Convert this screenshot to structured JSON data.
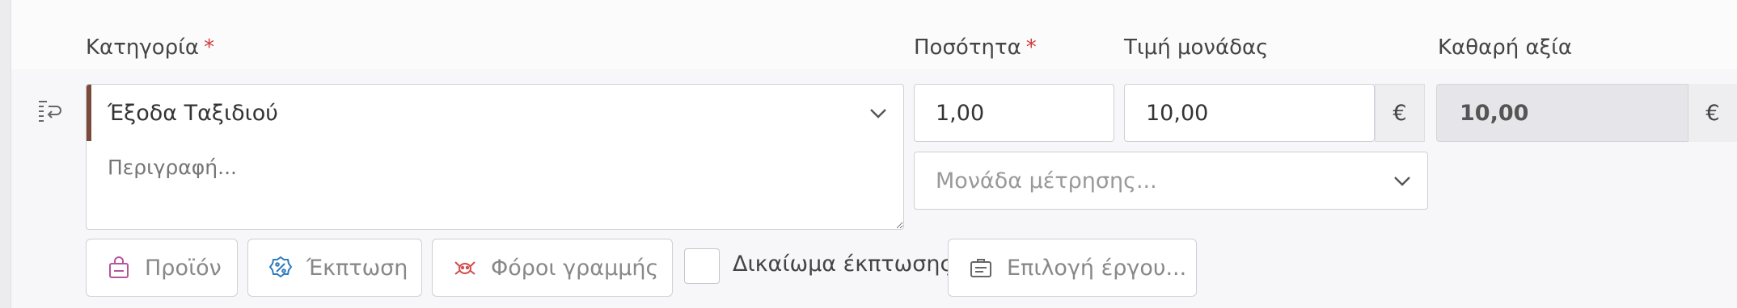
{
  "labels": {
    "category": "Κατηγορία",
    "quantity": "Ποσότητα",
    "unit_price": "Τιμή μονάδας",
    "net_value": "Καθαρή αξία",
    "required_mark": "*"
  },
  "category": {
    "selected": "Έξοδα Ταξιδιού",
    "accent_color": "#7a4a3a"
  },
  "description": {
    "placeholder": "Περιγραφή..."
  },
  "quantity": {
    "value": "1,00"
  },
  "unit_price": {
    "value": "10,00",
    "currency": "€"
  },
  "net_value": {
    "value": "10,00",
    "currency": "€"
  },
  "unit_of_measure": {
    "placeholder": "Μονάδα μέτρησης..."
  },
  "actions": {
    "product": "Προϊόν",
    "discount": "Έκπτωση",
    "line_taxes": "Φόροι γραμμής",
    "discount_right": "Δικαίωμα έκπτωσης",
    "select_project": "Επιλογή έργου..."
  },
  "colors": {
    "required": "#d23b3b",
    "product_icon": "#b5559a",
    "discount_icon": "#2f7bbf",
    "tax_icon": "#d24b4b"
  }
}
